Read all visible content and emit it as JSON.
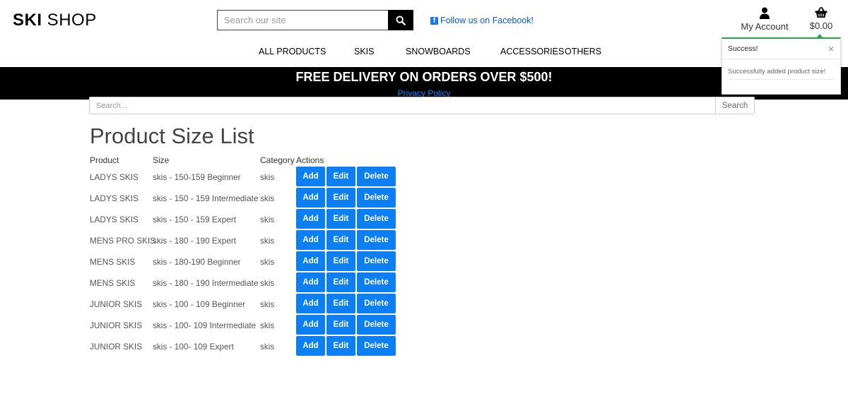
{
  "brand": {
    "bold": "SKI",
    "rest": " SHOP"
  },
  "top_search": {
    "placeholder": "Search our site"
  },
  "facebook": {
    "label": "Follow us on Facebook!"
  },
  "account": {
    "label": "My Account"
  },
  "cart": {
    "total": "$0.00"
  },
  "nav": {
    "all_products": "ALL PRODUCTS",
    "skis": "SKIS",
    "snowboards": "SNOWBOARDS",
    "accessories": "ACCESSORIES",
    "others": "OTHERS"
  },
  "banner": {
    "title": "FREE DELIVERY ON ORDERS OVER $500!",
    "link": "Privacy Policy"
  },
  "toast": {
    "title": "Success!",
    "close": "×",
    "message": "Successfully added product size!"
  },
  "main_search": {
    "placeholder": "Search...",
    "button": "Search"
  },
  "page_title": "Product Size List",
  "table": {
    "headers": {
      "product": "Product",
      "size": "Size",
      "category": "Category",
      "actions": "Actions"
    },
    "action_labels": {
      "add": "Add",
      "edit": "Edit",
      "delete": "Delete"
    },
    "rows": [
      {
        "product": "LADYS SKIS",
        "size": "skis - 150-159 Beginner",
        "category": "skis"
      },
      {
        "product": "LADYS SKIS",
        "size": "skis - 150 - 159 Intermediate",
        "category": "skis"
      },
      {
        "product": "LADYS SKIS",
        "size": "skis - 150 - 159 Expert",
        "category": "skis"
      },
      {
        "product": "MENS PRO SKIS",
        "size": "skis - 180 - 190 Expert",
        "category": "skis"
      },
      {
        "product": "MENS SKIS",
        "size": "skis - 180-190 Beginner",
        "category": "skis"
      },
      {
        "product": "MENS SKIS",
        "size": "skis - 180 - 190 Intermediate",
        "category": "skis"
      },
      {
        "product": "JUNIOR SKIS",
        "size": "skis - 100 - 109 Beginner",
        "category": "skis"
      },
      {
        "product": "JUNIOR SKIS",
        "size": "skis - 100- 109 Intermediate",
        "category": "skis"
      },
      {
        "product": "JUNIOR SKIS",
        "size": "skis - 100- 109 Expert",
        "category": "skis"
      }
    ]
  },
  "colors": {
    "primary_button": "#0d7ff5",
    "banner_bg": "#000000",
    "success": "#2aa34a",
    "link": "#0a58ca"
  },
  "icons": {
    "search": "search-icon",
    "facebook": "facebook-icon",
    "account": "user-icon",
    "cart": "basket-icon",
    "close": "close-icon"
  }
}
